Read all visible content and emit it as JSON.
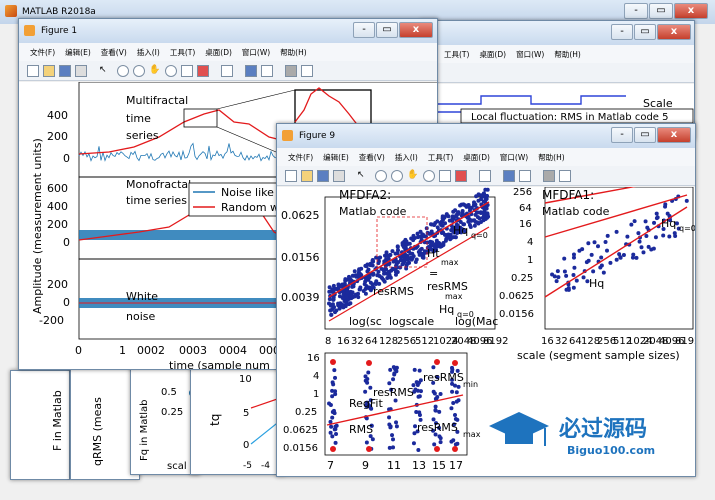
{
  "matlab": {
    "title": "MATLAB R2018a",
    "controls": [
      "-",
      "▭",
      "x"
    ]
  },
  "figure1": {
    "title": "Figure 1",
    "menu": [
      "文件(F)",
      "编辑(E)",
      "查看(V)",
      "插入(I)",
      "工具(T)",
      "桌面(D)",
      "窗口(W)",
      "帮助(H)"
    ],
    "ylabel": "Amplitude (measurement units)",
    "xlabel": "time (sample num",
    "xticks": [
      "0",
      "1",
      "0002",
      "0003",
      "0004",
      "0005"
    ],
    "p1": {
      "title": "Multifractal",
      "l2": "time",
      "l3": "series",
      "yt": [
        "400",
        "200",
        "0"
      ]
    },
    "p2": {
      "title": "Monofractal",
      "l2": "time series",
      "yt": [
        "600",
        "400",
        "200",
        "0"
      ],
      "leg1": "Noise like",
      "leg2": "Random w"
    },
    "p3": {
      "title": "White",
      "l2": "noise",
      "yt": [
        "200",
        "0",
        "-200"
      ]
    }
  },
  "figure9": {
    "title": "Figure 9",
    "menu": [
      "文件(F)",
      "编辑(E)",
      "查看(V)",
      "插入(I)",
      "工具(T)",
      "桌面(D)",
      "窗口(W)",
      "帮助(H)"
    ],
    "left": {
      "title": "MFDFA2:",
      "subtitle": "Matlab code",
      "yt": [
        "0.0625",
        "0.0156",
        "0.0039"
      ],
      "hq": "Hq",
      "hqsub": "q=0",
      "ht": "Ht",
      "htsub": "max",
      "eq": "=",
      "res": "resRMS",
      "ressub": "max",
      "hq2": "Hq",
      "hq2sub": "q=0",
      "logmac": "log(Mac",
      "logsc": "log(sc",
      "logscale": "logscale",
      "xt": [
        "8",
        "16",
        "32",
        "64",
        "128",
        "256",
        "512",
        "1024",
        "2048",
        "4096",
        "8192"
      ]
    },
    "right": {
      "title": "MFDFA1:",
      "subtitle": "Matlab code",
      "yt": [
        "256",
        "64",
        "16",
        "4",
        "1",
        "0.25",
        "0.0625",
        "0.0156"
      ],
      "hq": "Hq",
      "hqsub": "q=0",
      "hq2": "Hq",
      "xlabel": "scale (segment sample sizes)",
      "xt": [
        "16",
        "32",
        "64",
        "128",
        "256",
        "512",
        "1024",
        "2048",
        "4096",
        "8192"
      ]
    },
    "bottom": {
      "yt": [
        "16",
        "4",
        "1",
        "0.25",
        "0.0625",
        "0.0156"
      ],
      "xt": [
        "7",
        "9",
        "11",
        "13",
        "15",
        "17"
      ],
      "resrms": "resRMS",
      "resmin": "min",
      "resmax": "max",
      "rmsres": "resRMS",
      "rms": "RMS",
      "regfit": "RegFit"
    }
  },
  "back": {
    "scale": "Scale",
    "localfluct": "Local fluctuation: RMS in Matlab code 5",
    "fmatlab": "F in Matlab",
    "qrms": "qRMS (meas",
    "fq": "Fq in Matlab",
    "fqt": [
      "0.5",
      "0.25"
    ],
    "scal": "scal",
    "tq": "tq",
    "tqt": [
      "10",
      "5",
      "0"
    ],
    "tqx": [
      "-5",
      "-4"
    ]
  },
  "watermark": {
    "main": "必过源码",
    "sub": "Biguo100.com"
  }
}
